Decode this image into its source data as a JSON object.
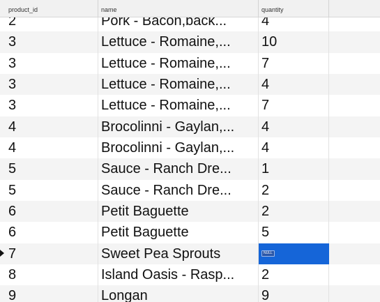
{
  "columns": {
    "product_id": "product_id",
    "name": "name",
    "quantity": "quantity"
  },
  "rows": [
    {
      "product_id": "2",
      "name": "Pork - Bacon,back...",
      "quantity": "4"
    },
    {
      "product_id": "3",
      "name": "Lettuce - Romaine,...",
      "quantity": "10"
    },
    {
      "product_id": "3",
      "name": "Lettuce - Romaine,...",
      "quantity": "7"
    },
    {
      "product_id": "3",
      "name": "Lettuce - Romaine,...",
      "quantity": "4"
    },
    {
      "product_id": "3",
      "name": "Lettuce - Romaine,...",
      "quantity": "7"
    },
    {
      "product_id": "4",
      "name": "Brocolinni - Gaylan,...",
      "quantity": "4"
    },
    {
      "product_id": "4",
      "name": "Brocolinni - Gaylan,...",
      "quantity": "4"
    },
    {
      "product_id": "5",
      "name": "Sauce - Ranch Dre...",
      "quantity": "1"
    },
    {
      "product_id": "5",
      "name": "Sauce - Ranch Dre...",
      "quantity": "2"
    },
    {
      "product_id": "6",
      "name": "Petit Baguette",
      "quantity": "2"
    },
    {
      "product_id": "6",
      "name": "Petit Baguette",
      "quantity": "5"
    },
    {
      "product_id": "7",
      "name": "Sweet Pea Sprouts",
      "quantity": "NULL"
    },
    {
      "product_id": "8",
      "name": "Island Oasis - Rasp...",
      "quantity": "2"
    },
    {
      "product_id": "9",
      "name": "Longan",
      "quantity": "9"
    }
  ],
  "selected_row": 11,
  "colors": {
    "selection": "#1565d8",
    "null_badge": "#2a56a8",
    "alt_row": "#f4f4f4"
  }
}
